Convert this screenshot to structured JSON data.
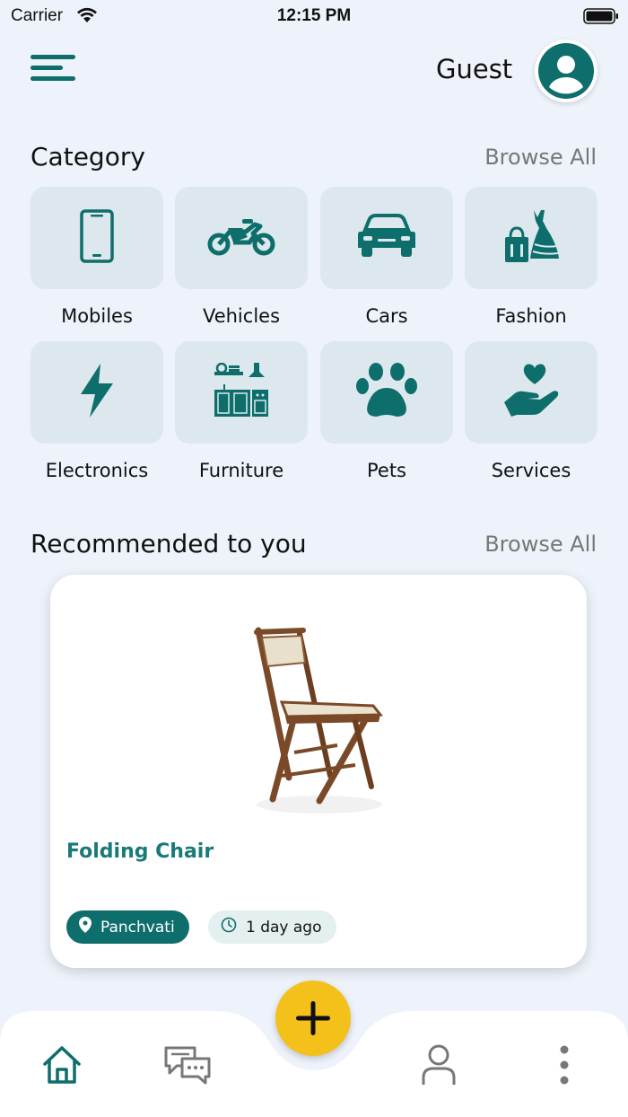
{
  "status_bar": {
    "carrier": "Carrier",
    "time": "12:15 PM"
  },
  "header": {
    "user_name": "Guest",
    "menu_icon": "hamburger-menu-icon",
    "avatar_icon": "user-avatar-icon"
  },
  "category": {
    "title": "Category",
    "browse_all": "Browse All",
    "items": [
      {
        "label": "Mobiles",
        "icon": "mobile-phone-icon"
      },
      {
        "label": "Vehicles",
        "icon": "motorcycle-icon"
      },
      {
        "label": "Cars",
        "icon": "car-icon"
      },
      {
        "label": "Fashion",
        "icon": "dress-shopping-icon"
      },
      {
        "label": "Electronics",
        "icon": "lightning-bolt-icon"
      },
      {
        "label": "Furniture",
        "icon": "kitchen-furniture-icon"
      },
      {
        "label": "Pets",
        "icon": "paw-icon"
      },
      {
        "label": "Services",
        "icon": "heart-hand-icon"
      }
    ]
  },
  "recommended": {
    "title": "Recommended to you",
    "browse_all": "Browse All",
    "items": [
      {
        "title": "Folding Chair",
        "location": "Panchvati",
        "posted": "1 day ago",
        "image": "folding-chair-image"
      }
    ]
  },
  "bottom_nav": {
    "items": [
      "home-icon",
      "chat-icon",
      "add-icon",
      "profile-icon",
      "more-vertical-icon"
    ]
  },
  "colors": {
    "accent": "#0e6e6b",
    "tile": "#dde8ee",
    "fab": "#f4c11b",
    "background": "#eef2fa"
  }
}
